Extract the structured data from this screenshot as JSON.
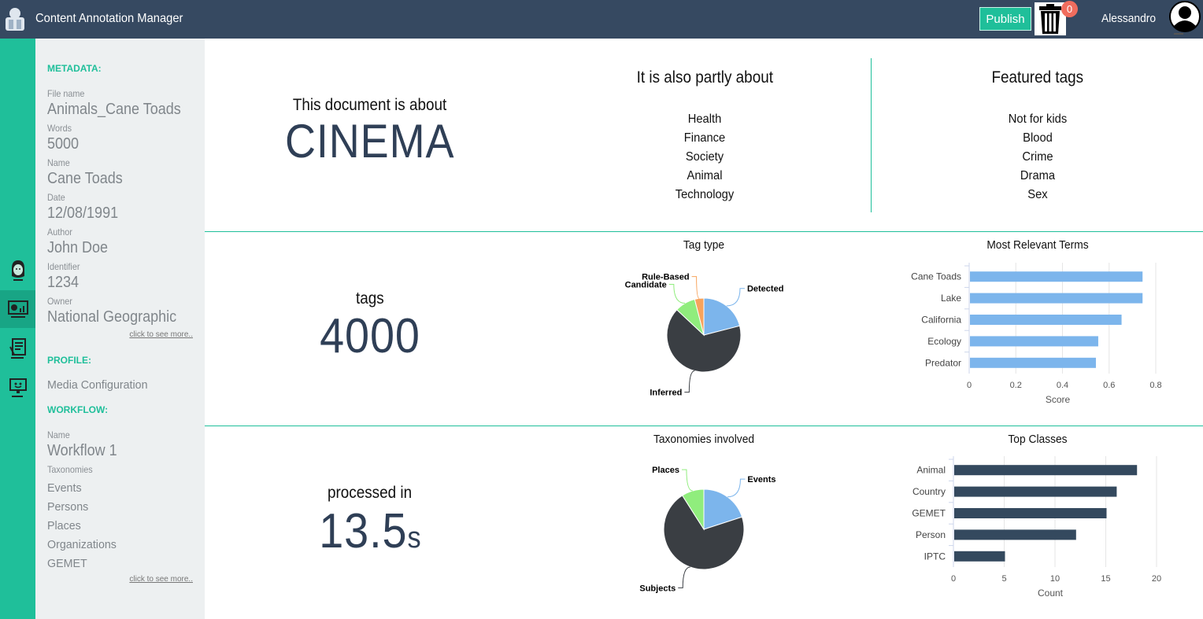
{
  "header": {
    "app_title": "Content Annotation Manager",
    "publish_label": "Publish",
    "trash_count": "0",
    "username": "Alessandro"
  },
  "rail": {
    "items": [
      "face-icon",
      "dashboard-icon",
      "document-icon",
      "monitor-icon"
    ],
    "active_index": 1
  },
  "metadata": {
    "heading": "METADATA:",
    "fields": [
      {
        "label": "File name",
        "value": "Animals_Cane Toads"
      },
      {
        "label": "Words",
        "value": "5000"
      },
      {
        "label": "Name",
        "value": "Cane Toads"
      },
      {
        "label": "Date",
        "value": "12/08/1991"
      },
      {
        "label": "Author",
        "value": "John Doe"
      },
      {
        "label": "Identifier",
        "value": "1234"
      },
      {
        "label": "Owner",
        "value": "National Geographic"
      }
    ],
    "see_more": "click to see more..",
    "profile_heading": "PROFILE:",
    "profile_value": "Media Configuration",
    "workflow_heading": "WORKFLOW:",
    "workflow_name_label": "Name",
    "workflow_name": "Workflow 1",
    "taxonomies_label": "Taxonomies",
    "taxonomies": [
      "Events",
      "Persons",
      "Places",
      "Organizations",
      "GEMET"
    ],
    "see_more_2": "click to see more.."
  },
  "about": {
    "heading": "This document is about",
    "topic": "CINEMA",
    "partly_heading": "It is also partly about",
    "partly": [
      "Health",
      "Finance",
      "Society",
      "Animal",
      "Technology"
    ],
    "featured_heading": "Featured tags",
    "featured": [
      "Not for kids",
      "Blood",
      "Crime",
      "Drama",
      "Sex"
    ]
  },
  "stats": {
    "tags_label": "tags",
    "tags_value": "4000",
    "processed_label": "processed in",
    "processed_value": "13.5",
    "processed_unit": "s"
  },
  "colors": {
    "accent": "#1fbf9a",
    "header": "#364961",
    "dark": "#3a3e43",
    "blue": "#7cb5ec",
    "green": "#90ed7d",
    "orange": "#f7a35c",
    "navy": "#34495e"
  },
  "chart_data": [
    {
      "type": "pie",
      "title": "Tag type",
      "slices": [
        {
          "name": "Detected",
          "value": 21
        },
        {
          "name": "Inferred",
          "value": 66
        },
        {
          "name": "Candidate",
          "value": 9
        },
        {
          "name": "Rule-Based",
          "value": 4
        }
      ]
    },
    {
      "type": "bar",
      "orientation": "horizontal",
      "title": "Most Relevant Terms",
      "categories": [
        "Cane Toads",
        "Lake",
        "California",
        "Ecology",
        "Predator"
      ],
      "values": [
        0.74,
        0.74,
        0.65,
        0.55,
        0.54
      ],
      "xlabel": "Score",
      "xlim": [
        0,
        0.8
      ],
      "ticks": [
        "0",
        "0.2",
        "0.4",
        "0.6",
        "0.8"
      ]
    },
    {
      "type": "pie",
      "title": "Taxonomies involved",
      "slices": [
        {
          "name": "Events",
          "value": 20
        },
        {
          "name": "Subjects",
          "value": 71
        },
        {
          "name": "Places",
          "value": 9
        }
      ]
    },
    {
      "type": "bar",
      "orientation": "horizontal",
      "title": "Top Classes",
      "categories": [
        "Animal",
        "Country",
        "GEMET",
        "Person",
        "IPTC"
      ],
      "values": [
        18,
        16,
        15,
        12,
        5
      ],
      "xlabel": "Count",
      "xlim": [
        0,
        20
      ],
      "ticks": [
        "0",
        "5",
        "10",
        "15",
        "20"
      ]
    }
  ]
}
